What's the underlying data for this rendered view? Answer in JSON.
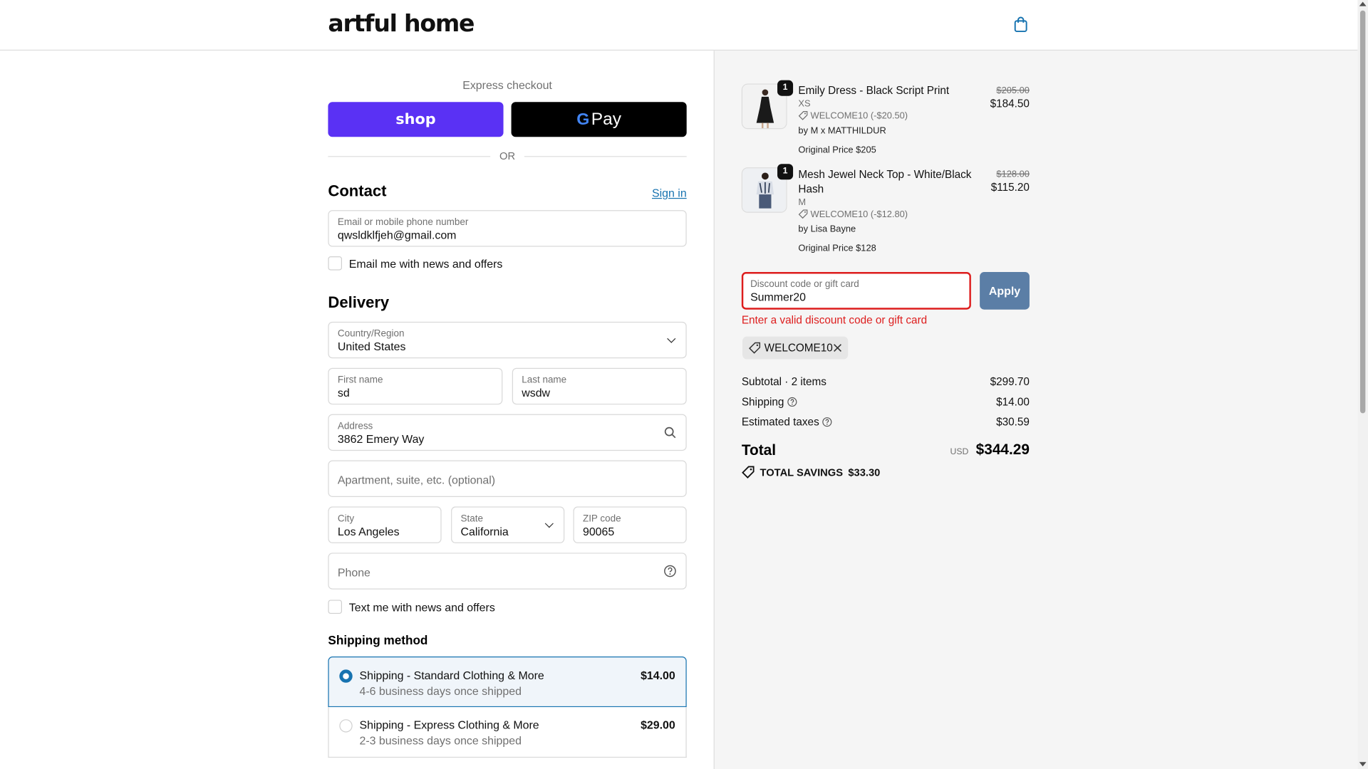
{
  "brand": {
    "logo": "artful home"
  },
  "express": {
    "label": "Express checkout",
    "shop_label": "shop",
    "gpay_g": "G",
    "gpay_pay": "Pay",
    "or_label": "OR"
  },
  "contact": {
    "title": "Contact",
    "signin_label": "Sign in",
    "email_label": "Email or mobile phone number",
    "email_value": "qwsldklfjeh@gmail.com",
    "news_label": "Email me with news and offers",
    "news_checked": false
  },
  "delivery": {
    "title": "Delivery",
    "country_label": "Country/Region",
    "country_value": "United States",
    "first_name_label": "First name",
    "first_name_value": "sd",
    "last_name_label": "Last name",
    "last_name_value": "wsdw",
    "address_label": "Address",
    "address_value": "3862 Emery Way",
    "apartment_placeholder": "Apartment, suite, etc. (optional)",
    "city_label": "City",
    "city_value": "Los Angeles",
    "state_label": "State",
    "state_value": "California",
    "zip_label": "ZIP code",
    "zip_value": "90065",
    "phone_placeholder": "Phone",
    "text_label": "Text me with news and offers",
    "text_checked": false
  },
  "shipping_method": {
    "title": "Shipping method",
    "options": [
      {
        "name": "Shipping - Standard Clothing & More",
        "desc": "4-6 business days once shipped",
        "price": "$14.00",
        "selected": true
      },
      {
        "name": "Shipping - Express Clothing & More",
        "desc": "2-3 business days once shipped",
        "price": "$29.00",
        "selected": false
      }
    ]
  },
  "order": {
    "items": [
      {
        "qty": "1",
        "name": "Emily Dress - Black Script Print",
        "variant": "XS",
        "discount": "WELCOME10 (-$20.50)",
        "by": "by M x MATTHILDUR",
        "original": "Original Price $205",
        "price_old": "$205.00",
        "price_new": "$184.50"
      },
      {
        "qty": "1",
        "name": "Mesh Jewel Neck Top - White/Black Hash",
        "variant": "M",
        "discount": "WELCOME10 (-$12.80)",
        "by": "by Lisa Bayne",
        "original": "Original Price $128",
        "price_old": "$128.00",
        "price_new": "$115.20"
      }
    ],
    "discount_label": "Discount code or gift card",
    "discount_value": "Summer20",
    "apply_label": "Apply",
    "error": "Enter a valid discount code or gift card",
    "applied_code": "WELCOME10",
    "subtotal_label": "Subtotal · 2 items",
    "subtotal_value": "$299.70",
    "shipping_label": "Shipping",
    "shipping_value": "$14.00",
    "taxes_label": "Estimated taxes",
    "taxes_value": "$30.59",
    "total_label": "Total",
    "total_currency": "USD",
    "total_value": "$344.29",
    "savings_label": "TOTAL SAVINGS",
    "savings_value": "$33.30"
  },
  "colors": {
    "shop_purple": "#5a31f4",
    "link_blue": "#1773b0",
    "error_red": "#dd1d1d",
    "apply_blue": "#5b7ea6"
  },
  "icons": [
    "shopping-bag-icon",
    "chevron-down-icon",
    "search-icon",
    "question-circle-icon",
    "tag-icon",
    "close-icon"
  ]
}
